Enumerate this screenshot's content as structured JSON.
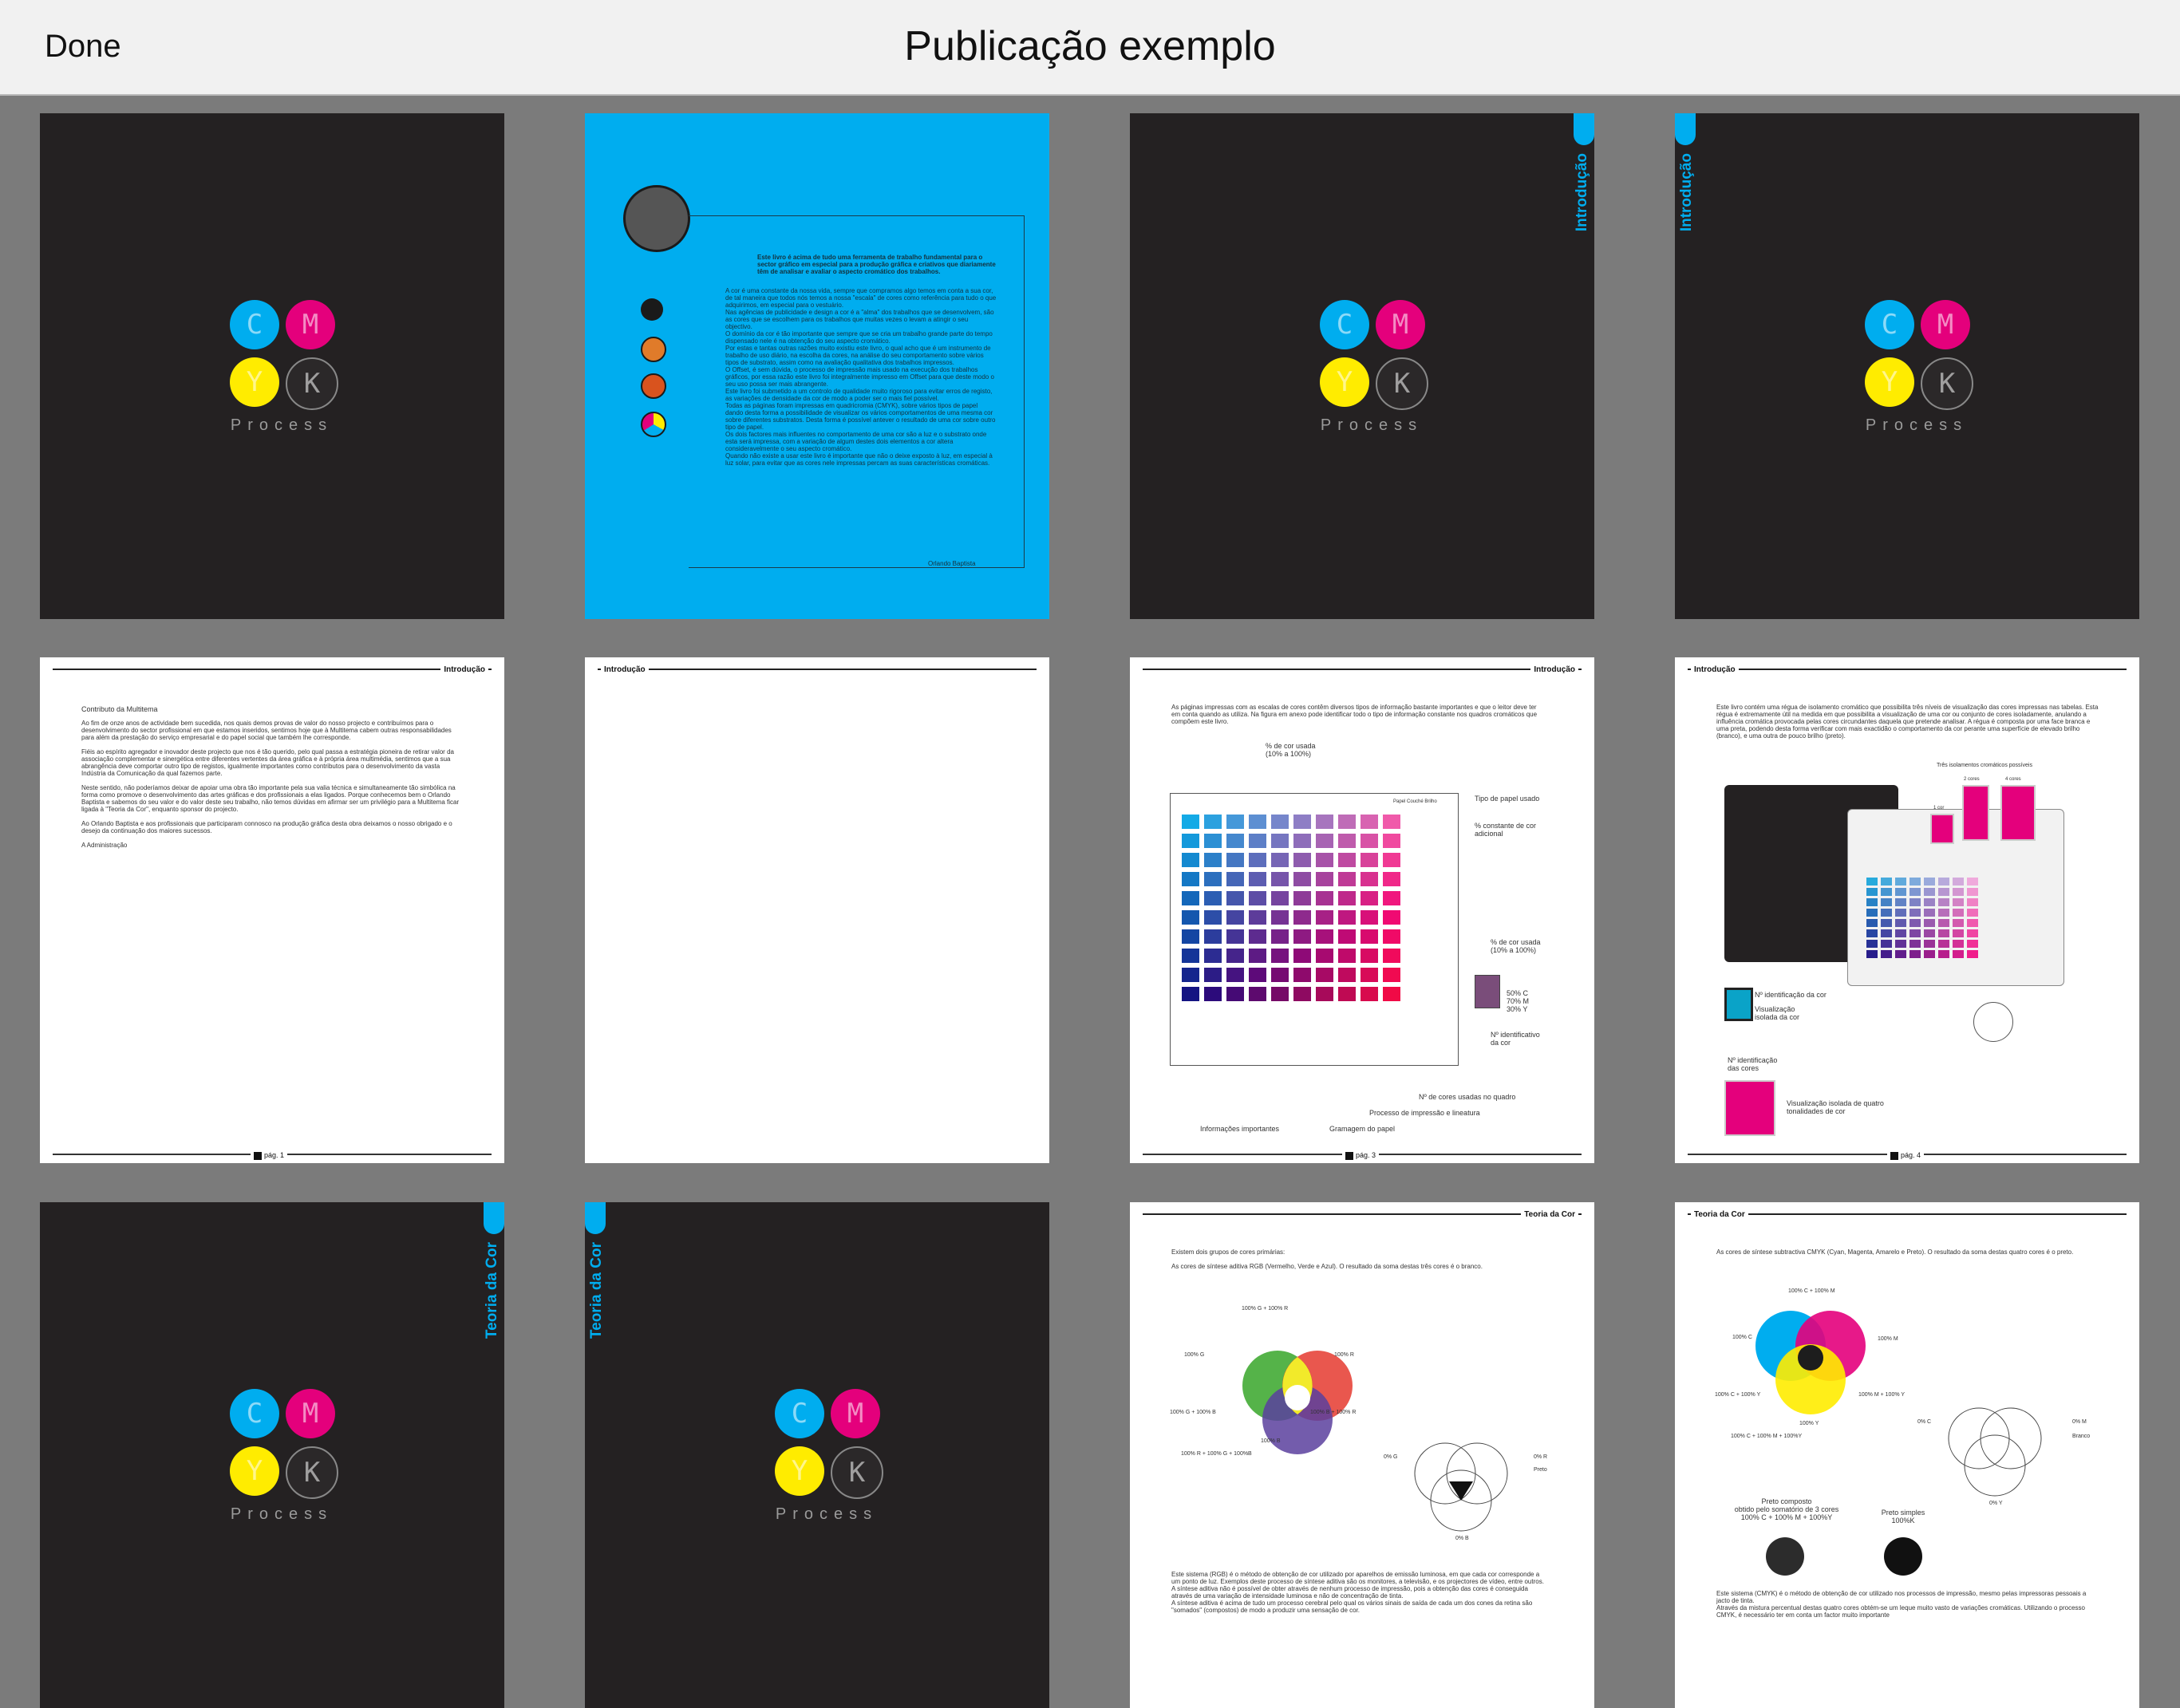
{
  "header": {
    "done_label": "Done",
    "title": "Publicação exemplo"
  },
  "cover": {
    "letters": [
      "C",
      "M",
      "Y",
      "K"
    ],
    "process": "Process"
  },
  "pages": {
    "p2": {
      "intro": "Este livro é acima de tudo uma ferramenta de trabalho fundamental para o sector gráfico em especial para a produção gráfica e criativos que diariamente têm de analisar e avaliar o aspecto cromático dos trabalhos.",
      "body": "A cor é uma constante da nossa vida, sempre que compramos algo temos em conta a sua cor, de tal maneira que todos nós temos a nossa \"escala\" de cores como referência para tudo o que adquirimos, em especial para o vestuário.\nNas agências de publicidade e design a cor é a \"alma\" dos trabalhos que se desenvolvem, são as cores que se escolhem para os trabalhos que muitas vezes o levam a atingir o seu objectivo.\nO domínio da cor é tão importante que sempre que se cria um trabalho grande parte do tempo dispensado nele é na obtenção do seu aspecto cromático.\nPor estas e tantas outras razões muito existiu este livro, o qual acho que é um instrumento de trabalho de uso diário, na escolha da cores, na análise do seu comportamento sobre vários tipos de substrato, assim como na avaliação qualitativa dos trabalhos impressos.\nO Offset, é sem dúvida, o processo de impressão mais usado na execução dos trabalhos gráficos, por essa razão este livro foi integralmente impresso em Offset para que deste modo o seu uso possa ser mais abrangente.\nEste livro foi submetido a um controlo de qualidade muito rigoroso para evitar erros de registo, as variações de densidade da cor de modo a poder ser o mais fiel possível.\nTodas as páginas foram impressas em quadricromia (CMYK), sobre vários tipos de papel dando desta forma a possibilidade de visualizar os vários comportamentos de uma mesma cor sobre diferentes substratos. Desta forma é possível antever o resultado de uma cor sobre outro tipo de papel.\nOs dois factores mais influentes no comportamento de uma cor são a luz e o substrato onde esta será impressa, com a variação de algum destes dois elementos a cor altera consideravelmente o seu aspecto cromático.\nQuando não existe a usar este livro é importante que não o deixe exposto à luz, em especial à luz solar, para evitar que as cores nele impressas percam as suas características cromáticas.",
      "signature": "Orlando Baptista"
    },
    "p3": {
      "tab": "Introdução"
    },
    "p4": {
      "tab": "Introdução"
    },
    "p5": {
      "header": "Introdução",
      "heading": "Contributo da Multitema",
      "body": "Ao fim de onze anos de actividade bem sucedida, nos quais demos provas de valor do nosso projecto e contribuímos para o desenvolvimento do sector profissional em que estamos inseridos, sentimos hoje que à Multitema cabem outras responsabilidades para além da prestação do serviço empresarial e do papel social que também lhe corresponde.\n\nFiéis ao espírito agregador e inovador deste projecto que nos é tão querido, pelo qual passa a estratégia pioneira de retirar valor da associação complementar e sinergética entre diferentes vertentes da área gráfica e à própria área multimédia, sentimos que a sua abrangência deve comportar outro tipo de registos, igualmente importantes como contributos para o desenvolvimento da vasta Indústria da Comunicação da qual fazemos parte.\n\nNeste sentido, não poderíamos deixar de apoiar uma obra tão importante pela sua valia técnica e simultaneamente tão simbólica na forma como promove o desenvolvimento das artes gráficas e dos profissionais a elas ligados. Porque conhecemos bem o Orlando Baptista e sabemos do seu valor e do valor deste seu trabalho, não temos dúvidas em afirmar ser um privilégio para a Multitema ficar ligada à \"Teoria da Cor\", enquanto sponsor do projecto.\n\nAo Orlando Baptista e aos profissionais que participaram connosco na produção gráfica desta obra deixamos o nosso obrigado e o desejo da continuação dos maiores sucessos.\n\nA Administração",
      "page": "pág. 1"
    },
    "p6": {
      "header": "Introdução"
    },
    "p7": {
      "header": "Introdução",
      "intro": "As páginas impressas com as escalas de cores contêm diversos tipos de informação bastante importantes e que o leitor deve ter em conta quando as utiliza. Na figura em anexo pode identificar todo o tipo de informação constante nos quadros cromáticos que compõem este livro.",
      "labels": [
        "% de cor usada\n(10% a 100%)",
        "Papel Couché Brilho",
        "Tipo de papel usado",
        "% constante de cor\nadicional",
        "% de cor usada\n(10% a 100%)",
        "50% C\n70% M\n30% Y",
        "Nº identificativo\nda cor",
        "Nº de cores usadas no quadro",
        "Processo de impressão e lineatura",
        "Gramagem do papel",
        "Informações importantes"
      ],
      "page": "pág. 3"
    },
    "p8": {
      "header": "Introdução",
      "intro": "Este livro contém uma régua de isolamento cromático que possibilita três níveis de visualização das cores impressas nas tabelas. Esta régua é extremamente útil na medida em que possibilita a visualização de uma cor ou conjunto de cores isoladamente, anulando a influência cromática provocada pelas cores circundantes daquela que pretende analisar. A régua é composta por uma face branca e uma preta, podendo desta forma verificar com mais exactidão o comportamento da cor perante uma superfície de elevado brilho (branco), e uma outra de pouco brilho (preto).",
      "labels": [
        "Três isolamentos cromáticos possíveis",
        "1 cor",
        "2 cores",
        "4 cores",
        "Nº identificação da cor",
        "Visualização isolada da cor",
        "Nº identificação das cores",
        "Visualização isolada de quatro tonalidades de cor"
      ],
      "page": "pág. 4"
    },
    "p9": {
      "tab": "Teoria da Cor"
    },
    "p10": {
      "tab": "Teoria da Cor"
    },
    "p11": {
      "header": "Teoria da Cor",
      "l1": "Existem dois grupos de cores primárias:",
      "l2": "As cores de síntese aditiva RGB (Vermelho, Verde e Azul). O resultado da soma destas três cores é o branco.",
      "labels": [
        "100% G + 100% R",
        "100% G",
        "100% R",
        "100% G + 100% B",
        "100% B + 100% R",
        "100% B",
        "100% R + 100% G + 100%B",
        "0% G",
        "0% R",
        "Preto",
        "0% B"
      ],
      "bottom": "Este sistema (RGB) é o método de obtenção de cor utilizado por aparelhos de emissão luminosa, em que cada cor corresponde a um ponto de luz. Exemplos deste processo de síntese aditiva são os monitores, a televisão, e os projectores de vídeo, entre outros.\nA síntese aditiva não é possível de obter através de nenhum processo de impressão, pois a obtenção das cores é conseguida através de uma variação de intensidade luminosa e não de concentração de tinta.\nA síntese aditiva é acima de tudo um processo cerebral pelo qual os vários sinais de saída de cada um dos cones da retina são \"somados\" (compostos) de modo a produzir uma sensação de cor."
    },
    "p12": {
      "header": "Teoria da Cor",
      "l1": "As cores de síntese subtractiva CMYK (Cyan, Magenta, Amarelo e Preto). O resultado da soma destas quatro cores é o preto.",
      "labels": [
        "100% C + 100% M",
        "100% C",
        "100% M",
        "100% C + 100% Y",
        "100% M + 100% Y",
        "100% Y",
        "100% C + 100% M + 100%Y",
        "0% C",
        "0% M",
        "Branco",
        "0% Y",
        "Preto composto\nobtido pelo somatório de 3 cores\n100% C + 100% M + 100%Y",
        "Preto simples\n100%K"
      ],
      "bottom": "Este sistema (CMYK) é o método de obtenção de cor utilizado nos processos de impressão, mesmo pelas impressoras pessoais a jacto de tinta.\nAtravés da mistura percentual destas quatro cores obtém-se um leque muito vasto de variações cromáticas. Utilizando o processo CMYK, é necessário ter em conta um factor muito importante"
    }
  },
  "colors": {
    "cyan": "#00adef",
    "magenta": "#e4007c",
    "yellow": "#ffec00",
    "dark": "#242122",
    "red": "#e53a2f"
  }
}
